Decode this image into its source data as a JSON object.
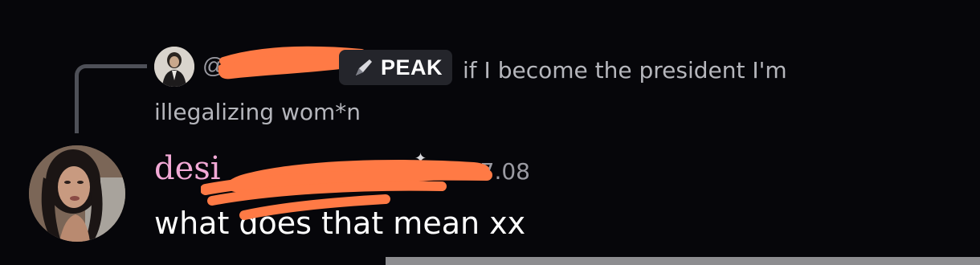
{
  "reply": {
    "at_prefix": "@",
    "role_badge": "PEAK",
    "role_icon": "pen-icon",
    "text": "if I become the president I'm illegalizing wom*n"
  },
  "message": {
    "username": "desi",
    "timestamp": "7.08",
    "content": "what does that mean xx"
  },
  "colors": {
    "background": "#06060a",
    "username": "#f2a9d6",
    "redaction": "#ff7a45",
    "badge_bg": "#24252b",
    "muted_text": "#b5b6bc"
  }
}
